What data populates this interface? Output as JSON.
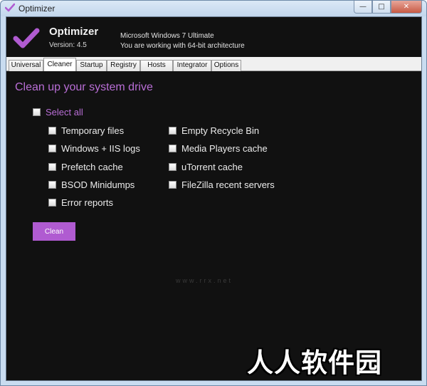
{
  "window": {
    "title": "Optimizer",
    "controls": {
      "minimize": "—",
      "maximize": "□",
      "close": "✕"
    }
  },
  "header": {
    "app_name": "Optimizer",
    "version": "Version: 4.5",
    "os": "Microsoft Windows 7 Ultimate",
    "architecture": "You are working with 64-bit architecture"
  },
  "tabs": [
    {
      "label": "Universal"
    },
    {
      "label": "Cleaner",
      "active": true
    },
    {
      "label": "Startup"
    },
    {
      "label": "Registry"
    },
    {
      "label": "Hosts"
    },
    {
      "label": "Integrator"
    },
    {
      "label": "Options"
    }
  ],
  "cleaner": {
    "title": "Clean up your system drive",
    "select_all": "Select all",
    "options_left": [
      "Temporary files",
      "Windows + IIS logs",
      "Prefetch cache",
      "BSOD Minidumps",
      "Error reports"
    ],
    "options_right": [
      "Empty Recycle Bin",
      "Media Players cache",
      "uTorrent cache",
      "FileZilla recent servers"
    ],
    "clean_button": "Clean"
  },
  "watermark": {
    "text": "人人软件园",
    "faint_url": "www.rrx.net"
  },
  "colors": {
    "accent": "#b96ed6",
    "button": "#b05bd1",
    "background": "#111111",
    "title_bar": "#c9dcf0"
  },
  "icons": {
    "app": "checkmark-icon",
    "logo": "checkmark-icon"
  }
}
